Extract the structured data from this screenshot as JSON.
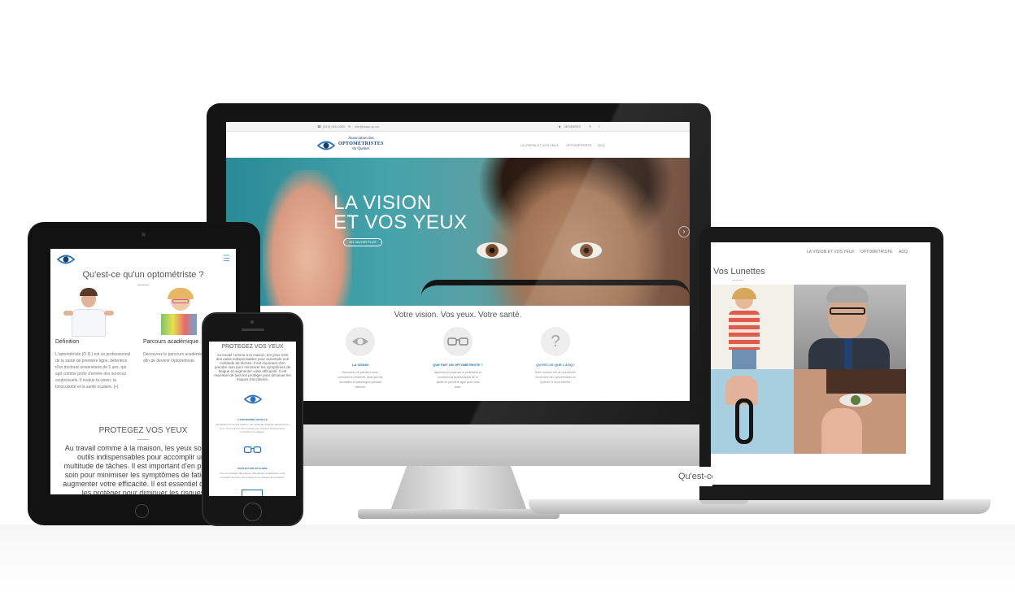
{
  "desktop": {
    "topbar": {
      "phone": "(514) 000-0000",
      "email": "info@aoqc.qc.ca",
      "members": "MEMBRES"
    },
    "logo": {
      "line1": "Association des",
      "line2": "OPTOMÉTRISTES",
      "line3": "du Québec"
    },
    "nav": [
      "LA VISION ET VOS YEUX",
      "OPTOMÉTRISTE",
      "AOQ"
    ],
    "hero": {
      "title_line1": "LA VISION",
      "title_line2": "ET VOS YEUX",
      "button": "EN SAVOIR PLUS"
    },
    "section_title": "Votre vision. Vos yeux. Votre santé.",
    "features": [
      {
        "icon": "eye-icon",
        "title": "LA VISION",
        "desc": "Découvrez ce précieux sens, comment le préserver, ainsi que les anomalies et pathologies pouvant l'affecter."
      },
      {
        "icon": "glasses-icon",
        "title": "QUE FAIT UN OPTOMÉTRISTE ?",
        "desc": "Apprenez-en plus sur la profession et comment ce professionnel de la santé de première ligne peut vous aider."
      },
      {
        "icon": "question-icon",
        "title": "QU'EST-CE QUE L'AOQ?",
        "desc": "Notre mission est de représenter l'ensemble des optométristes du Québec et leurs intérêts."
      }
    ]
  },
  "laptop": {
    "nav": [
      "LA VISION ET VOS YEUX",
      "OPTOMÉTRISTE",
      "AOQ"
    ],
    "title": "Vos Lunettes",
    "bottom_title": "Qu'est-ce qu'un optométriste ?"
  },
  "tablet": {
    "title": "Qu'est-ce qu'un optométriste ?",
    "col1_label": "Définition",
    "col1_text": "L'optométriste (O.D.) est un professionnel de la santé de première ligne, détenteur d'un doctorat universitaire de 5 ans, qui agit comme porte d'entrée des services oculovisuels. Il évalue la vision, la binocularité et la santé oculaire. [+]",
    "col2_label": "Parcours académique",
    "col2_text": "Découvrez le parcours académique afin de devenir Optométriste.",
    "section_title": "PROTEGEZ VOS YEUX",
    "section_text": "Au travail comme à la maison, les yeux sont des outils indispensables pour accomplir une multitude de tâches. Il est important d'en prendre soin pour minimiser les symptômes de fatigue et augmenter votre efficacité. Il est essentiel de bien les protéger pour diminuer les risques d'accidents."
  },
  "phone": {
    "title": "PROTEGEZ VOS YEUX",
    "text": "Au travail comme à la maison, les yeux sont des outils indispensables pour accomplir une multitude de tâches. Il est important d'en prendre soin pour minimiser les symptômes de fatigue et augmenter votre efficacité. Il est essentiel de bien les protéger pour diminuer les risques d'accidents.",
    "feature1": "L'ERGONOMIE VISUELLE",
    "feature1_text": "Au travail comme à la maison, une multitude d'agents agressent vos yeux. Comment en tenir compte pour prévenir la sécheresse, l'inconfort et la fatigue.",
    "feature2": "PROTECTION OCULAIRE",
    "feature2_text": "Pour se protéger des risques d'accidents ou blessures, il est important de porter une lunette ou un masque de protection."
  },
  "colors": {
    "accent": "#1f6fa6",
    "logo": "#1a3f6b",
    "menu": "#6aaad2"
  }
}
